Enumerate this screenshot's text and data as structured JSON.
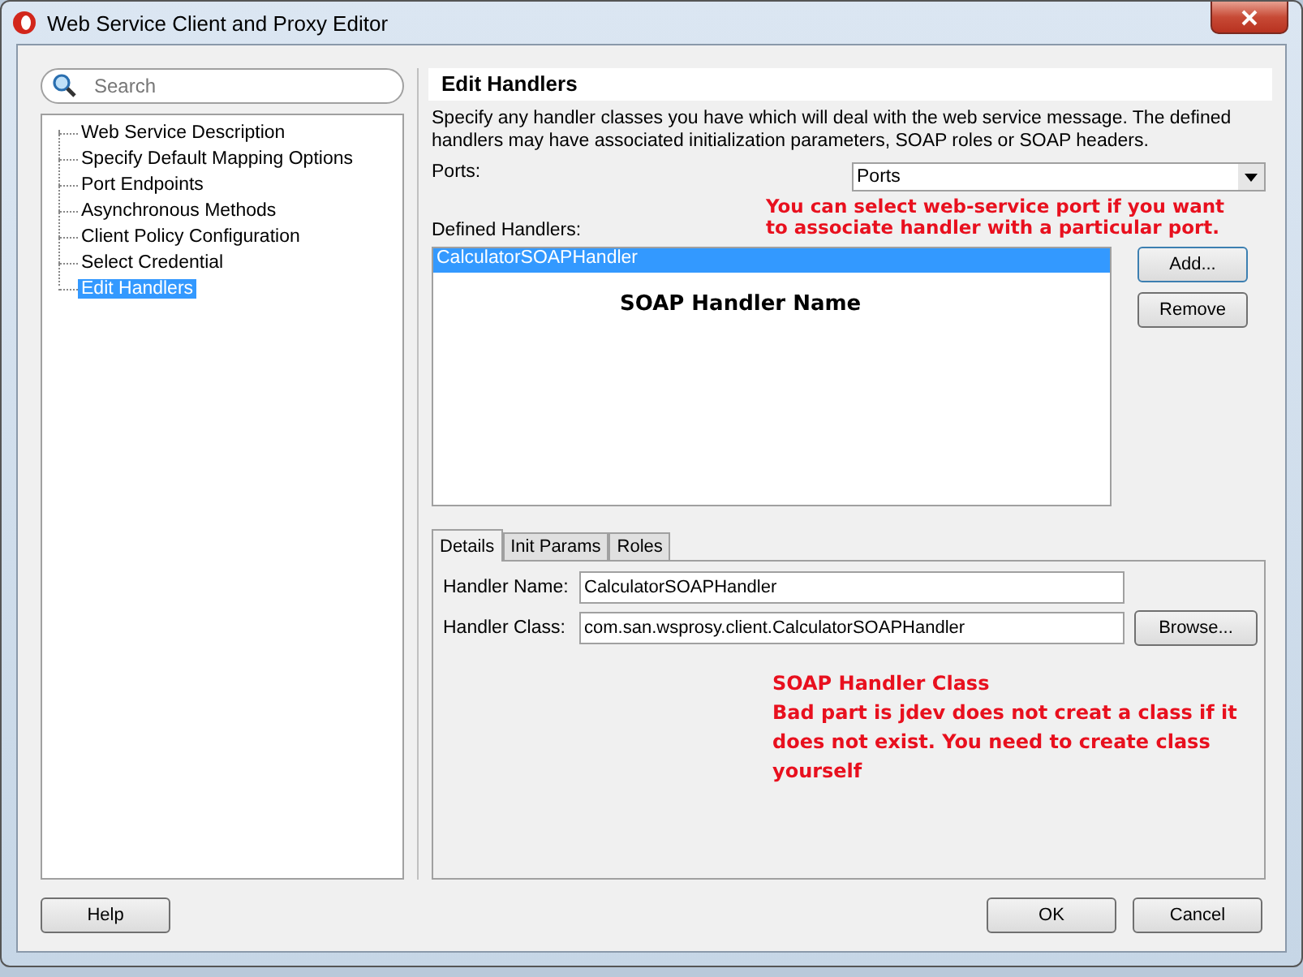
{
  "window": {
    "title": "Web Service Client and Proxy Editor"
  },
  "search": {
    "placeholder": "Search"
  },
  "navigation": [
    {
      "label": "Web Service Description",
      "selected": false
    },
    {
      "label": "Specify Default Mapping Options",
      "selected": false
    },
    {
      "label": "Port Endpoints",
      "selected": false
    },
    {
      "label": "Asynchronous Methods",
      "selected": false
    },
    {
      "label": "Client Policy Configuration",
      "selected": false
    },
    {
      "label": "Select Credential",
      "selected": false
    },
    {
      "label": "Edit Handlers",
      "selected": true
    }
  ],
  "page": {
    "heading": "Edit Handlers",
    "description": "Specify any handler classes you have which will deal with the web service message. The defined handlers may have associated initialization parameters, SOAP roles or SOAP headers.",
    "ports_label": "Ports:",
    "ports_value": "Ports",
    "handlers_label": "Defined Handlers:",
    "handlers": [
      {
        "label": "CalculatorSOAPHandler",
        "selected": true
      }
    ],
    "handler_buttons": [
      "Add...",
      "Remove"
    ]
  },
  "detail_tabs": [
    {
      "label": "Details",
      "selected": true
    },
    {
      "label": "Init Params",
      "selected": false
    },
    {
      "label": "Roles",
      "selected": false
    }
  ],
  "details": {
    "name_label": "Handler Name:",
    "name_value": "CalculatorSOAPHandler",
    "class_label": "Handler Class:",
    "class_value": "com.san.wsprosy.client.CalculatorSOAPHandler",
    "browse": "Browse..."
  },
  "annotations": {
    "ports_note": "You can select web-service port if you want to associate handler with a particular port.",
    "name_note": "SOAP Handler Name",
    "class_note_title": "SOAP Handler Class",
    "class_note": "Bad part is jdev does not creat a class if it does not exist. You need to create class yourself"
  },
  "footer": {
    "help": "Help",
    "ok": "OK",
    "cancel": "Cancel"
  }
}
